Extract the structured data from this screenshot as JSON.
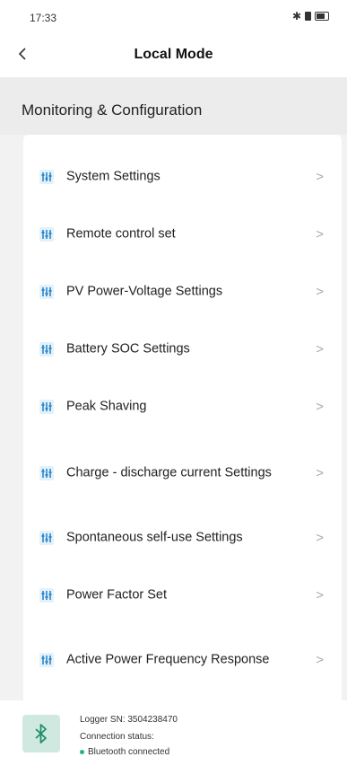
{
  "status_bar": {
    "time": "17:33"
  },
  "nav": {
    "back_icon": "chevron-left-icon",
    "title": "Local Mode"
  },
  "section": {
    "title": "Monitoring & Configuration"
  },
  "menu": {
    "icon": "sliders-icon",
    "icon_color": "#2a86c9",
    "chevron": ">",
    "items": [
      {
        "label": "System Settings"
      },
      {
        "label": "Remote control set"
      },
      {
        "label": "PV Power-Voltage Settings"
      },
      {
        "label": "Battery SOC Settings"
      },
      {
        "label": "Peak Shaving"
      },
      {
        "label": "Charge - discharge current Settings"
      },
      {
        "label": "Spontaneous self-use Settings"
      },
      {
        "label": "Power Factor Set"
      },
      {
        "label": "Active Power Frequency Response"
      }
    ]
  },
  "device": {
    "badge_icon": "bluetooth-icon",
    "badge_color": "#cfe9e1",
    "logger_label": "Logger SN:",
    "logger_sn": "3504238470",
    "connection_label": "Connection status:",
    "connection_value": "Bluetooth connected",
    "connection_color": "#22b573"
  }
}
